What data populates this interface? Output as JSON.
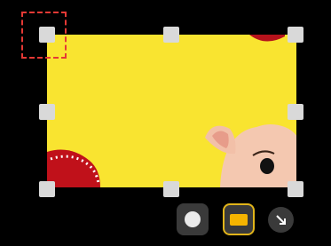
{
  "screen": {
    "description_type": "crop-tool"
  },
  "crop_selection": {
    "fill_color": "#f9e430",
    "handles": [
      "top-left",
      "top-middle",
      "top-right",
      "middle-left",
      "middle-right",
      "bottom-left",
      "bottom-middle",
      "bottom-right"
    ]
  },
  "highlight": {
    "color": "#e53935"
  },
  "toolbar": {
    "tools": [
      {
        "name": "circle",
        "icon": "circle-icon",
        "selected": false
      },
      {
        "name": "rectangle",
        "icon": "rectangle-icon",
        "selected": true,
        "accent": "#e2b51a"
      },
      {
        "name": "arrow",
        "icon": "arrow-down-right-icon",
        "selected": false
      }
    ]
  }
}
